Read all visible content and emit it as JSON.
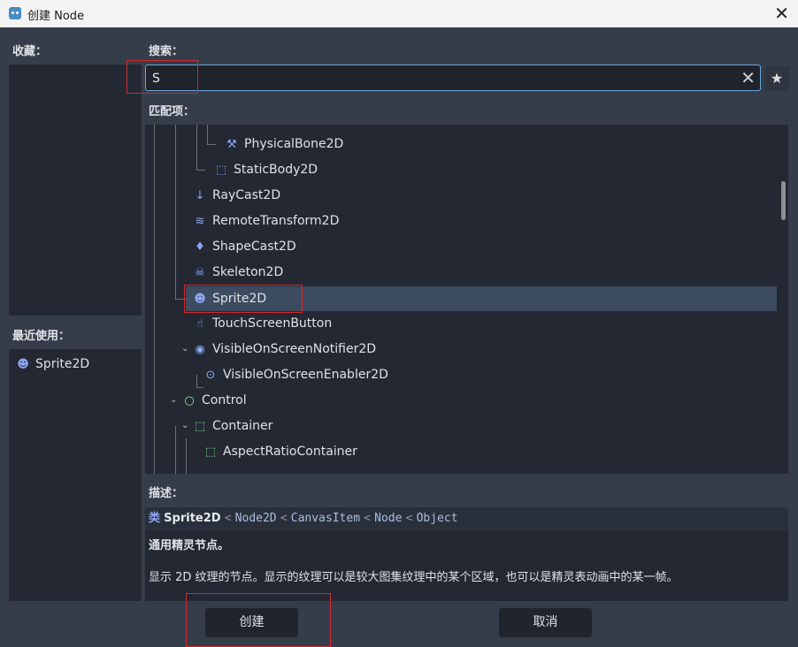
{
  "window": {
    "title": "创建 Node",
    "close_label": "✕"
  },
  "favorites": {
    "label": "收藏："
  },
  "recent": {
    "label": "最近使用：",
    "items": [
      {
        "label": "Sprite2D",
        "icon": "sprite-icon"
      }
    ]
  },
  "search": {
    "label": "搜索：",
    "value": "S",
    "placeholder": "",
    "clear_label": "✕",
    "fav_label": "★"
  },
  "matches": {
    "label": "匹配项：",
    "items": [
      {
        "label": "PhysicalBone2D",
        "icon": "bone-icon"
      },
      {
        "label": "StaticBody2D",
        "icon": "static-body-icon"
      },
      {
        "label": "RayCast2D",
        "icon": "raycast-icon"
      },
      {
        "label": "RemoteTransform2D",
        "icon": "remote-transform-icon"
      },
      {
        "label": "ShapeCast2D",
        "icon": "shapecast-icon"
      },
      {
        "label": "Skeleton2D",
        "icon": "skeleton-icon"
      },
      {
        "label": "Sprite2D",
        "icon": "sprite-icon",
        "selected": true
      },
      {
        "label": "TouchScreenButton",
        "icon": "touch-button-icon"
      },
      {
        "label": "VisibleOnScreenNotifier2D",
        "icon": "notifier-icon"
      },
      {
        "label": "VisibleOnScreenEnabler2D",
        "icon": "enabler-icon"
      },
      {
        "label": "Control",
        "icon": "control-icon"
      },
      {
        "label": "Container",
        "icon": "container-icon"
      },
      {
        "label": "AspectRatioContainer",
        "icon": "container-icon"
      }
    ]
  },
  "description": {
    "label": "描述：",
    "class_kw": "类",
    "class_name": "Sprite2D",
    "sep": "<",
    "inherits": [
      "Node2D",
      "CanvasItem",
      "Node",
      "Object"
    ],
    "brief": "通用精灵节点。",
    "full": "显示 2D 纹理的节点。显示的纹理可以是较大图集纹理中的某个区域，也可以是精灵表动画中的某一帧。"
  },
  "buttons": {
    "create": "创建",
    "cancel": "取消"
  },
  "colors": {
    "accent": "#6aa7d9",
    "selection": "#3c4b60",
    "annotation_red": "#d9262c",
    "icon_blue": "#8da5f3",
    "control_green": "#8eef97"
  }
}
